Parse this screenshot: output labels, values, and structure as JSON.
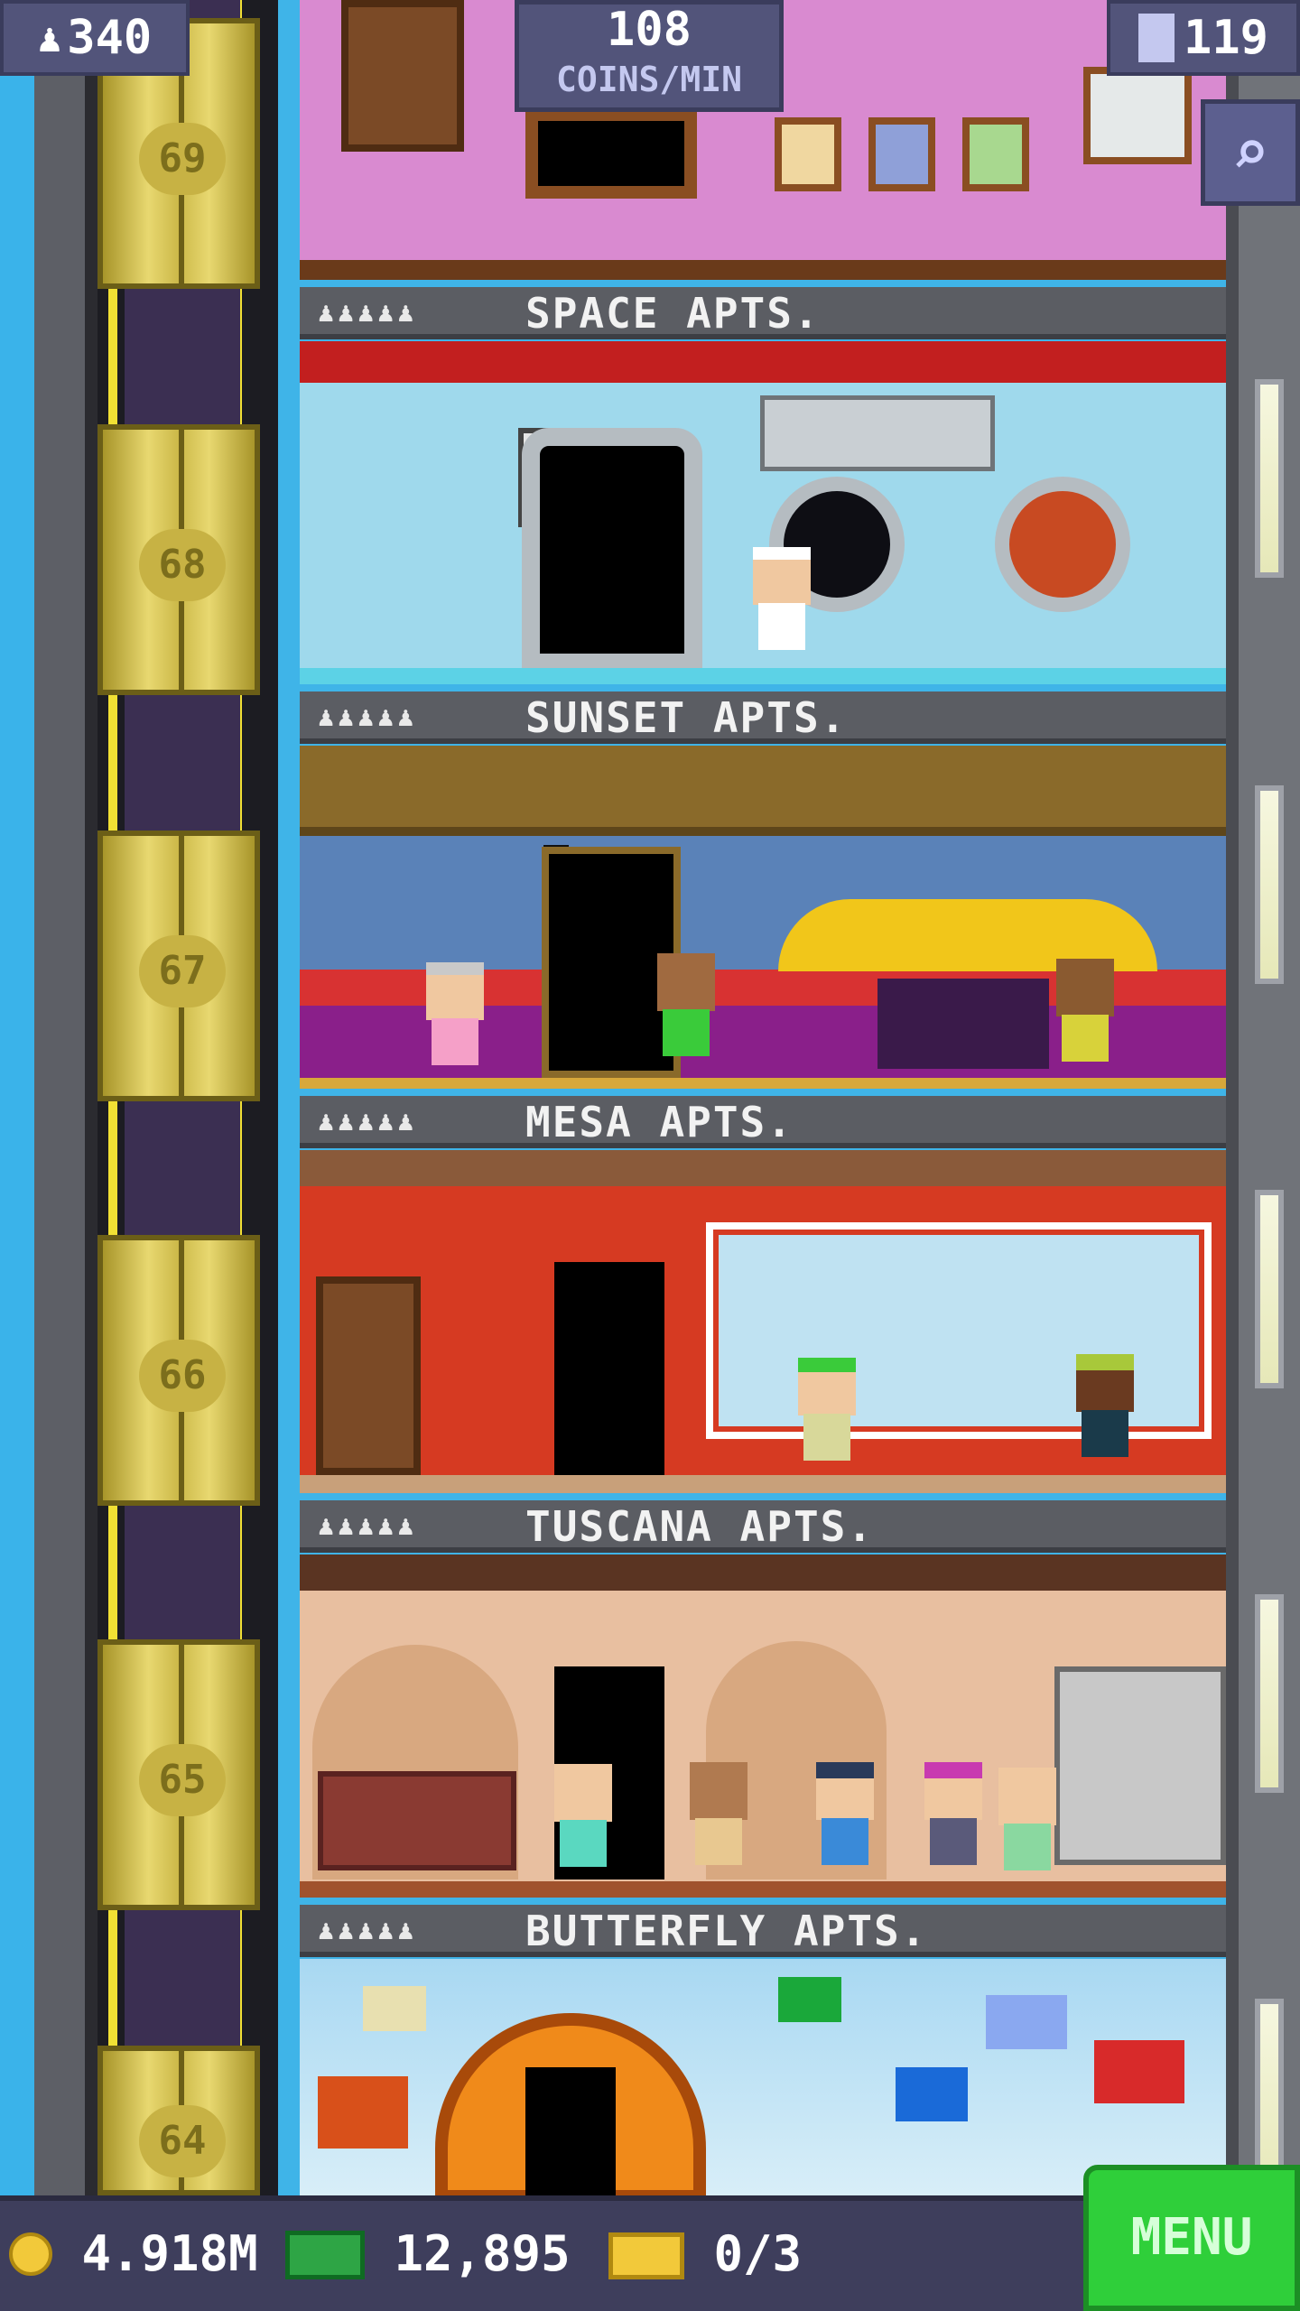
{
  "hud": {
    "population": "340",
    "coins_per_min_value": "108",
    "coins_per_min_label": "COINS/MIN",
    "floors_count": "119",
    "coins": "4.918M",
    "bux": "12,895",
    "tickets": "0/3",
    "menu_label": "MENU"
  },
  "elevator": {
    "floors": [
      "69",
      "68",
      "67",
      "66",
      "65",
      "64"
    ]
  },
  "floors": [
    {
      "name": "SPACE APTS.",
      "stars": "♟♟♟♟♟"
    },
    {
      "name": "SUNSET APTS.",
      "stars": "♟♟♟♟♟"
    },
    {
      "name": "MESA APTS.",
      "stars": "♟♟♟♟♟"
    },
    {
      "name": "TUSCANA APTS.",
      "stars": "♟♟♟♟♟"
    },
    {
      "name": "BUTTERFLY APTS.",
      "stars": "♟♟♟♟♟"
    }
  ],
  "colors": {
    "sky": "#3ab3ea",
    "hud_panel": "#52547a",
    "menu": "#2fcf3a",
    "elevator_gold": "#e8d870"
  }
}
